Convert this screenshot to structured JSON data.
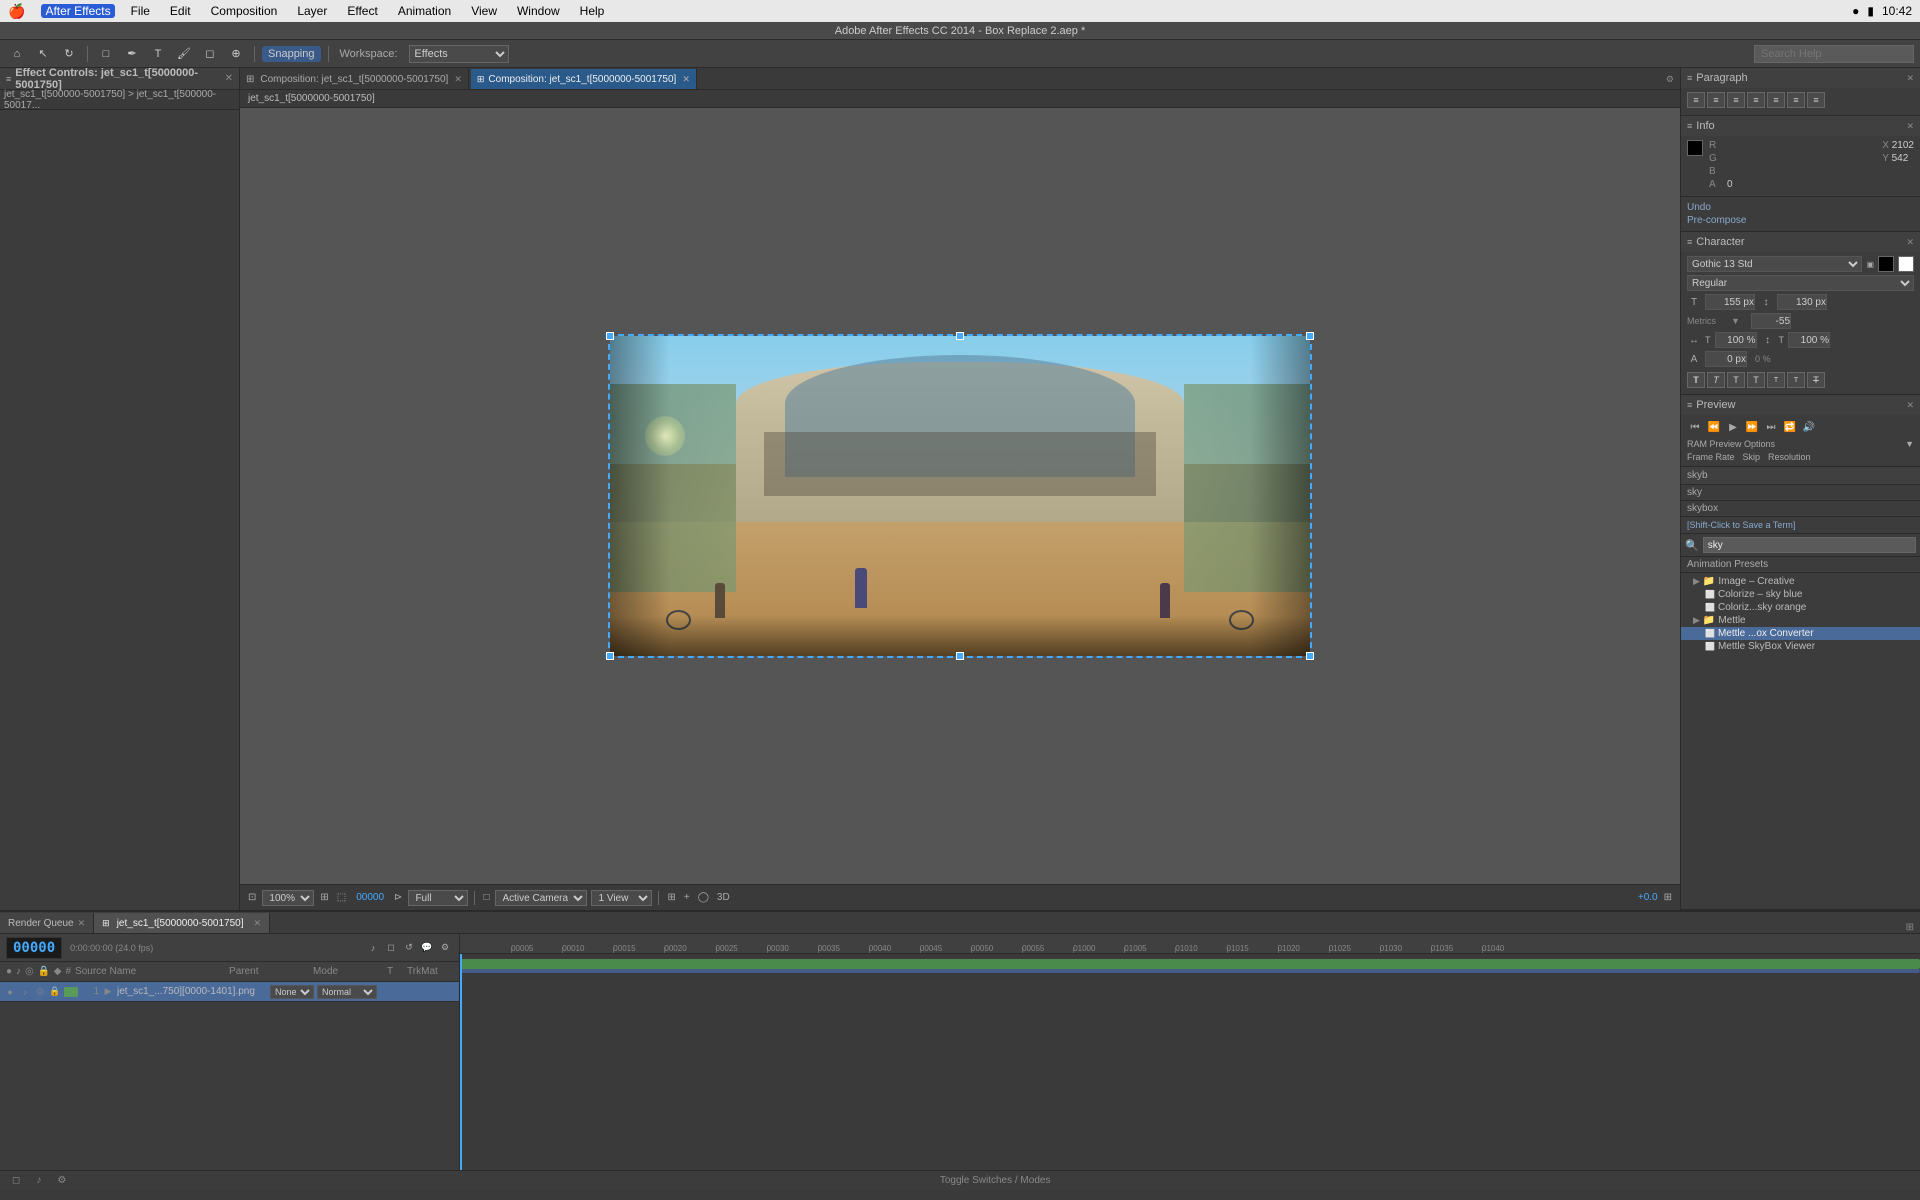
{
  "app": {
    "name": "After Effects",
    "title_bar": "Adobe After Effects CC 2014 - Box Replace 2.aep *"
  },
  "mac_menubar": {
    "apple": "⌘",
    "app_menu": "After Effects",
    "menus": [
      "File",
      "Edit",
      "Composition",
      "Layer",
      "Effect",
      "Animation",
      "View",
      "Window",
      "Help"
    ]
  },
  "toolbar": {
    "snapping_label": "Snapping"
  },
  "workspace": {
    "label": "Workspace:",
    "selected": "Effects"
  },
  "search_help": {
    "placeholder": "Search Help"
  },
  "left_panel": {
    "title": "Effect Controls: jet_sc1_t[5000000-5001750]",
    "breadcrumb": "jet_sc1_t[500000-5001750] > jet_sc1_t[500000-50017..."
  },
  "composition": {
    "tab1": "Composition: jet_sc1_t[5000000-5001750]",
    "tab2": "Composition: jet_sc1_t[5000000-5001750]",
    "view_label": "jet_sc1_t[5000000-5001750]"
  },
  "viewer_toolbar": {
    "zoom": "100%",
    "timecode": "00000",
    "quality": "Full",
    "camera": "Active Camera",
    "views": "1 View",
    "plus_value": "+0.0",
    "render_queue_label": "Render Queue"
  },
  "paragraph_panel": {
    "title": "Paragraph"
  },
  "info_panel": {
    "title": "Info",
    "r_label": "R",
    "g_label": "G",
    "b_label": "B",
    "a_label": "A",
    "r_value": "",
    "g_value": "",
    "b_value": "",
    "a_value": "0",
    "x_label": "X",
    "y_label": "Y",
    "x_value": "2102",
    "y_value": "542"
  },
  "preview_panel": {
    "title": "Preview",
    "ram_label": "RAM Preview Options",
    "frame_rate_label": "Frame Rate",
    "skip_label": "Skip",
    "resolution_label": "Resolution"
  },
  "character_panel": {
    "title": "Character",
    "font": "Gothic 13 Std",
    "style": "Regular",
    "size": "155 px",
    "leading": "130 px",
    "tracking_label": "Metrics",
    "tracking_value": "-55",
    "scale_h": "100 %",
    "scale_v": "100 %",
    "baseline": "0 px",
    "tsume": "0 %"
  },
  "animation_presets": {
    "title": "Animation Presets",
    "search_placeholder": "sky",
    "items": [
      {
        "type": "folder",
        "name": "Image – Creative",
        "indent": 1,
        "children": [
          {
            "type": "file",
            "name": "Colorize – sky blue",
            "indent": 2
          },
          {
            "type": "file",
            "name": "Coloriz...sky orange",
            "indent": 2
          }
        ]
      },
      {
        "type": "folder",
        "name": "Mettle",
        "indent": 1,
        "children": [
          {
            "type": "file",
            "name": "Mettle ...ox Converter",
            "indent": 2,
            "selected": true
          },
          {
            "type": "file",
            "name": "Mettle SkyBox Viewer",
            "indent": 2
          }
        ]
      }
    ],
    "sky_options": [
      "skyb",
      "sky",
      "skybox"
    ],
    "actions": {
      "undo": "Undo",
      "precompose": "Pre-compose"
    }
  },
  "timeline": {
    "render_queue_tab": "Render Queue",
    "comp_tab": "jet_sc1_t[5000000-5001750]",
    "timecode": "00000",
    "fps": "0:00:00:00 (24.0 fps)",
    "columns": {
      "source": "Source Name",
      "parent": "Parent",
      "mode": "Mode",
      "t": "T",
      "trkmat": "TrkMat"
    },
    "layers": [
      {
        "num": "1",
        "name": "jet_sc1_...750][0000-1401].png",
        "parent": "None",
        "mode": "Normal",
        "selected": true
      }
    ],
    "ruler_marks": [
      "00005",
      "00010",
      "00015",
      "00020",
      "00025",
      "00030",
      "00035",
      "00040",
      "00045",
      "00050",
      "00055",
      "01000",
      "01005",
      "01010",
      "01015",
      "01020",
      "01025",
      "01030",
      "01035",
      "01040"
    ]
  },
  "status_bar": {
    "toggle_label": "Toggle Switches / Modes"
  }
}
